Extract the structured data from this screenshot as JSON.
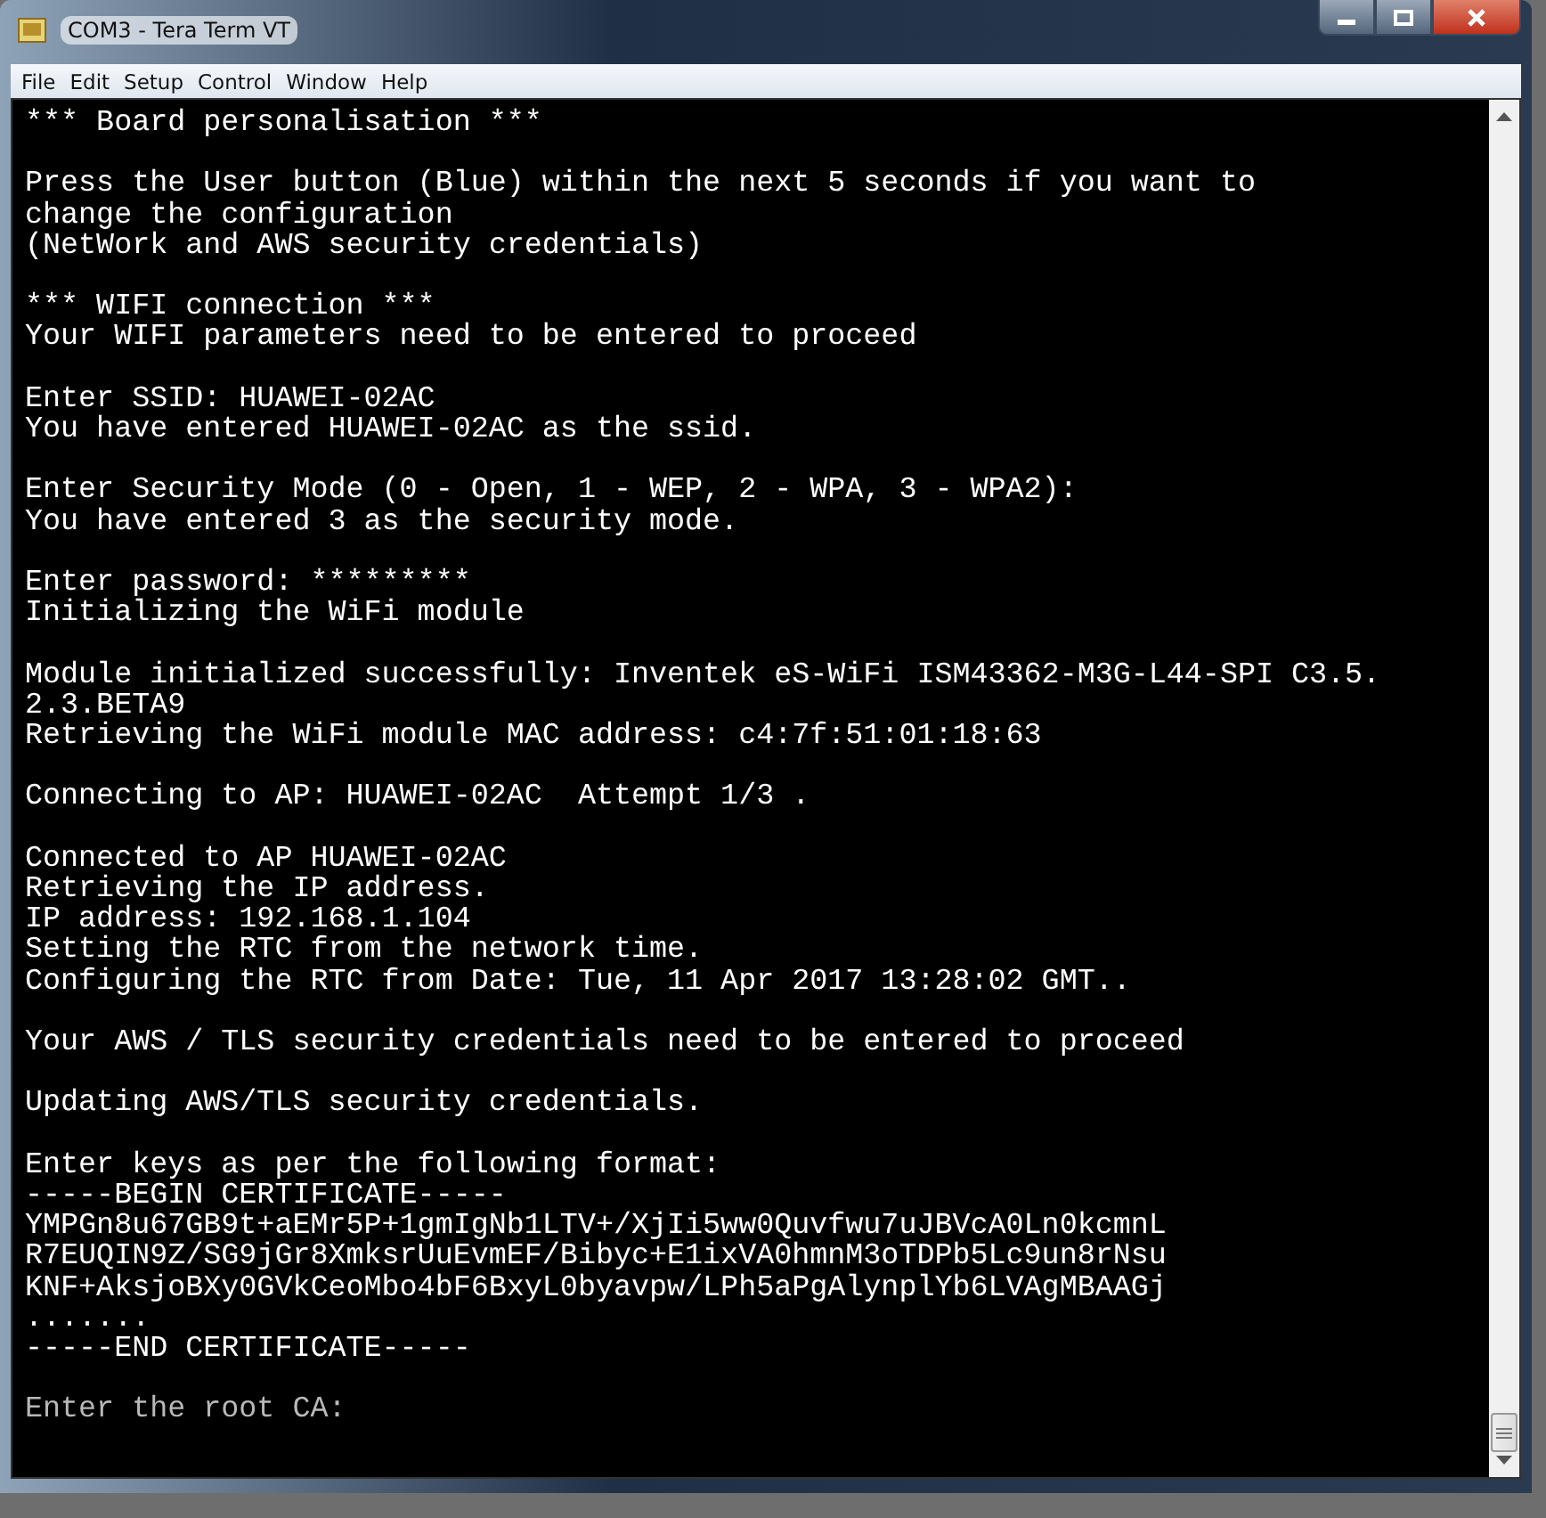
{
  "window": {
    "title": "COM3 - Tera Term VT"
  },
  "menu": [
    "File",
    "Edit",
    "Setup",
    "Control",
    "Window",
    "Help"
  ],
  "terminal": {
    "paragraphs": [
      {
        "lines": [
          "*** Board personalisation ***"
        ]
      },
      {
        "lines": [
          "Press the User button (Blue) within the next 5 seconds if you want to",
          "change the configuration",
          "(NetWork and AWS security credentials)"
        ]
      },
      {
        "lines": [
          "*** WIFI connection ***",
          "Your WIFI parameters need to be entered to proceed"
        ]
      },
      {
        "lines": [
          "Enter SSID: HUAWEI-02AC",
          "You have entered HUAWEI-02AC as the ssid."
        ]
      },
      {
        "lines": [
          "Enter Security Mode (0 - Open, 1 - WEP, 2 - WPA, 3 - WPA2):",
          "You have entered 3 as the security mode."
        ]
      },
      {
        "lines": [
          "Enter password: *********",
          "Initializing the WiFi module"
        ]
      },
      {
        "lines": [
          "Module initialized successfully: Inventek eS-WiFi ISM43362-M3G-L44-SPI C3.5.",
          "2.3.BETA9",
          "Retrieving the WiFi module MAC address: c4:7f:51:01:18:63"
        ]
      },
      {
        "lines": [
          "Connecting to AP: HUAWEI-02AC  Attempt 1/3 ."
        ]
      },
      {
        "lines": [
          "Connected to AP HUAWEI-02AC",
          "Retrieving the IP address.",
          "IP address: 192.168.1.104",
          "Setting the RTC from the network time.",
          "Configuring the RTC from Date: Tue, 11 Apr 2017 13:28:02 GMT.."
        ]
      },
      {
        "lines": [
          "Your AWS / TLS security credentials need to be entered to proceed"
        ]
      },
      {
        "lines": [
          "Updating AWS/TLS security credentials."
        ]
      },
      {
        "lines": [
          "Enter keys as per the following format:",
          "-----BEGIN CERTIFICATE-----",
          "YMPGn8u67GB9t+aEMr5P+1gmIgNb1LTV+/XjIi5ww0Quvfwu7uJBVcA0Ln0kcmnL",
          "R7EUQIN9Z/SG9jGr8XmksrUuEvmEF/Bibyc+E1ixVA0hmnM3oTDPb5Lc9un8rNsu",
          "KNF+AksjoBXy0GVkCeoMbo4bF6BxyL0byavpw/LPh5aPgAlynplYb6LVAgMBAAGj",
          ".......",
          "-----END CERTIFICATE-----"
        ]
      },
      {
        "lines": [
          "Enter the root CA:"
        ],
        "dim": true
      }
    ]
  }
}
